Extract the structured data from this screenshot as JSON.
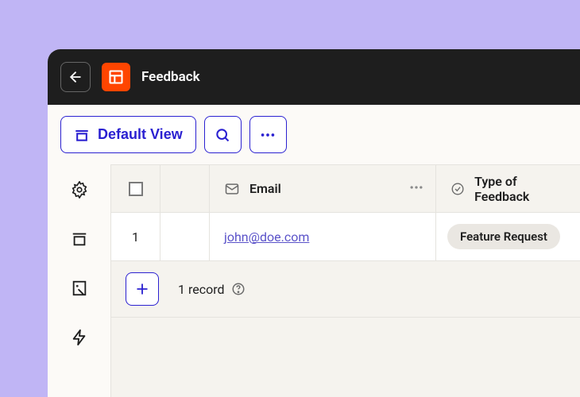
{
  "header": {
    "title": "Feedback"
  },
  "toolbar": {
    "view_label": "Default View"
  },
  "columns": {
    "email": "Email",
    "type": "Type of Feedback"
  },
  "rows": [
    {
      "num": "1",
      "email": "john@doe.com",
      "type": "Feature Request"
    }
  ],
  "footer": {
    "count": "1 record"
  }
}
